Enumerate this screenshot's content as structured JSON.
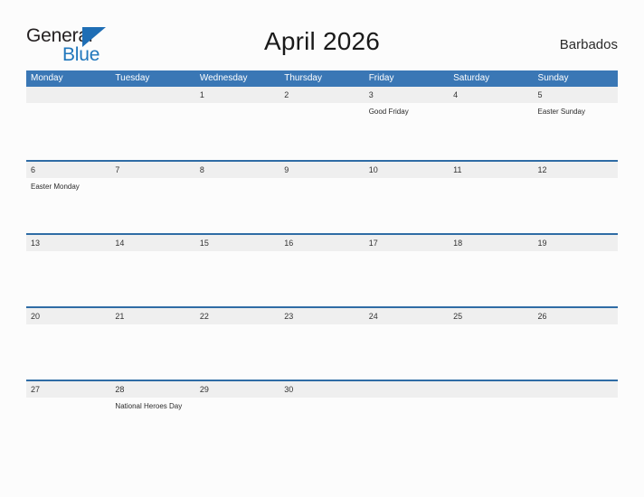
{
  "brand": {
    "name_part1": "General",
    "name_part2": "Blue",
    "color_dark": "#231f20",
    "color_blue": "#2077bc"
  },
  "header": {
    "title": "April 2026",
    "country": "Barbados"
  },
  "theme": {
    "header_blue": "#3a77b5",
    "row_divider_blue": "#2f6ca5",
    "date_band_gray": "#efefef",
    "page_background": "#fcfcfc"
  },
  "calendar": {
    "weekdays": [
      "Monday",
      "Tuesday",
      "Wednesday",
      "Thursday",
      "Friday",
      "Saturday",
      "Sunday"
    ],
    "weeks": [
      [
        {
          "date": "",
          "events": []
        },
        {
          "date": "",
          "events": []
        },
        {
          "date": "1",
          "events": []
        },
        {
          "date": "2",
          "events": []
        },
        {
          "date": "3",
          "events": [
            "Good Friday"
          ]
        },
        {
          "date": "4",
          "events": []
        },
        {
          "date": "5",
          "events": [
            "Easter Sunday"
          ]
        }
      ],
      [
        {
          "date": "6",
          "events": [
            "Easter Monday"
          ]
        },
        {
          "date": "7",
          "events": []
        },
        {
          "date": "8",
          "events": []
        },
        {
          "date": "9",
          "events": []
        },
        {
          "date": "10",
          "events": []
        },
        {
          "date": "11",
          "events": []
        },
        {
          "date": "12",
          "events": []
        }
      ],
      [
        {
          "date": "13",
          "events": []
        },
        {
          "date": "14",
          "events": []
        },
        {
          "date": "15",
          "events": []
        },
        {
          "date": "16",
          "events": []
        },
        {
          "date": "17",
          "events": []
        },
        {
          "date": "18",
          "events": []
        },
        {
          "date": "19",
          "events": []
        }
      ],
      [
        {
          "date": "20",
          "events": []
        },
        {
          "date": "21",
          "events": []
        },
        {
          "date": "22",
          "events": []
        },
        {
          "date": "23",
          "events": []
        },
        {
          "date": "24",
          "events": []
        },
        {
          "date": "25",
          "events": []
        },
        {
          "date": "26",
          "events": []
        }
      ],
      [
        {
          "date": "27",
          "events": []
        },
        {
          "date": "28",
          "events": [
            "National Heroes Day"
          ]
        },
        {
          "date": "29",
          "events": []
        },
        {
          "date": "30",
          "events": []
        },
        {
          "date": "",
          "events": []
        },
        {
          "date": "",
          "events": []
        },
        {
          "date": "",
          "events": []
        }
      ]
    ]
  }
}
